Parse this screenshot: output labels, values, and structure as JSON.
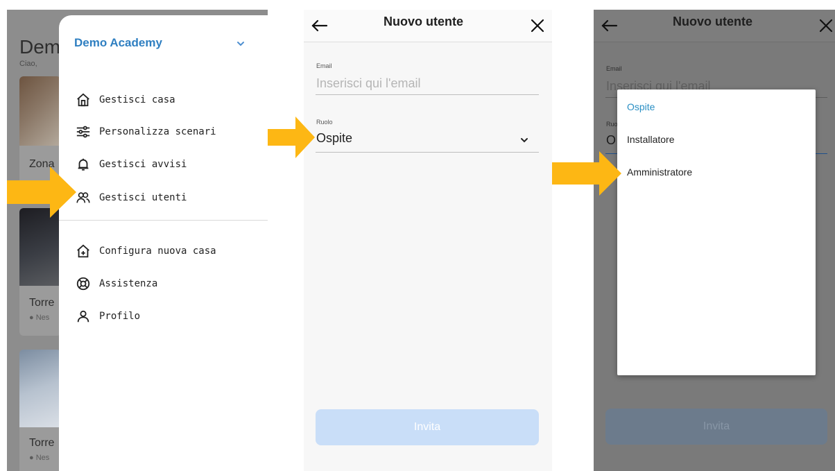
{
  "colors": {
    "accent": "#2f7fc1",
    "arrow": "#fdb714",
    "invite_disabled": "#c9def8",
    "option_selected": "#2a8fc4"
  },
  "panel1": {
    "background": {
      "title_partial": "Dem",
      "greeting_partial": "Ciao,",
      "zone_partial": "Zona",
      "card2_label": "Torre",
      "card2_status": "Nes",
      "card3_label": "Torre",
      "card3_status": "Nes"
    },
    "drawer": {
      "home_name": "Demo Academy",
      "expand_icon": "chevron-down-icon",
      "items_primary": [
        {
          "label": "Gestisci casa",
          "icon": "house-icon"
        },
        {
          "label": "Personalizza scenari",
          "icon": "sliders-icon"
        },
        {
          "label": "Gestisci avvisi",
          "icon": "bell-icon"
        },
        {
          "label": "Gestisci utenti",
          "icon": "users-icon"
        }
      ],
      "items_secondary": [
        {
          "label": "Configura nuova casa",
          "icon": "house-add-icon"
        },
        {
          "label": "Assistenza",
          "icon": "lifebuoy-icon"
        },
        {
          "label": "Profilo",
          "icon": "user-icon"
        }
      ]
    }
  },
  "panel2": {
    "header": {
      "title": "Nuovo utente",
      "back_icon": "arrow-left-icon",
      "close_icon": "close-icon"
    },
    "email": {
      "label": "Email",
      "placeholder": "Inserisci qui l'email"
    },
    "role": {
      "label": "Ruolo",
      "value": "Ospite",
      "dropdown_icon": "chevron-down-icon"
    },
    "invite_label": "Invita"
  },
  "panel3": {
    "header": {
      "title": "Nuovo utente"
    },
    "email": {
      "label": "Email",
      "placeholder": "Inserisci qui l'email"
    },
    "role": {
      "label": "Ruo",
      "value": "O"
    },
    "options": [
      {
        "label": "Ospite",
        "selected": true
      },
      {
        "label": "Installatore",
        "selected": false
      },
      {
        "label": "Amministratore",
        "selected": false
      }
    ],
    "invite_label": "Invita"
  }
}
